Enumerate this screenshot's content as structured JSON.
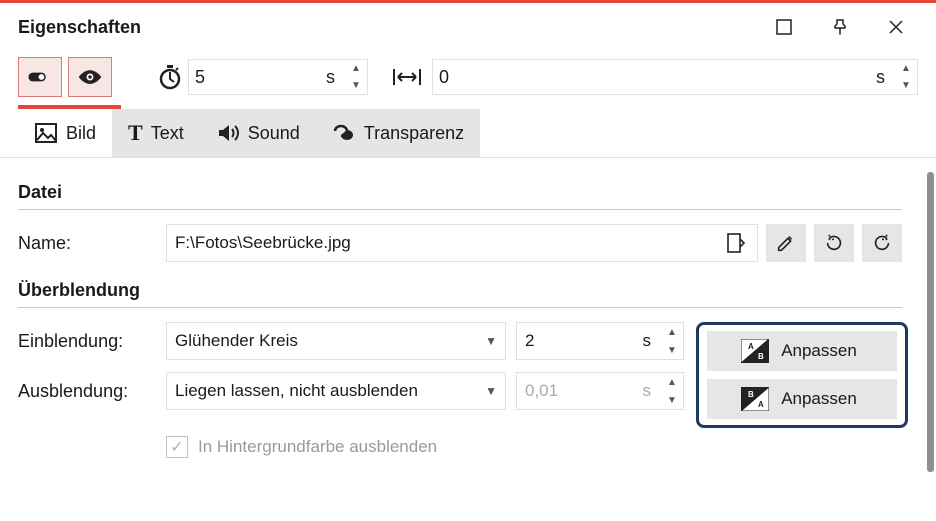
{
  "window": {
    "title": "Eigenschaften"
  },
  "toolbar": {
    "duration_value": "5",
    "duration_unit": "s",
    "spacing_value": "0",
    "spacing_unit": "s"
  },
  "tabs": {
    "bild": "Bild",
    "text": "Text",
    "sound": "Sound",
    "transparenz": "Transparenz"
  },
  "sections": {
    "datei": "Datei",
    "ueberblendung": "Überblendung"
  },
  "file": {
    "name_label": "Name:",
    "path": "F:\\Fotos\\Seebrücke.jpg"
  },
  "blend": {
    "in_label": "Einblendung:",
    "out_label": "Ausblendung:",
    "in_transition": "Glühender Kreis",
    "out_transition": "Liegen lassen, nicht ausblenden",
    "in_duration": "2",
    "out_duration": "0,01",
    "unit": "s",
    "anpassen": "Anpassen",
    "bg_fade_label": "In Hintergrundfarbe ausblenden"
  }
}
